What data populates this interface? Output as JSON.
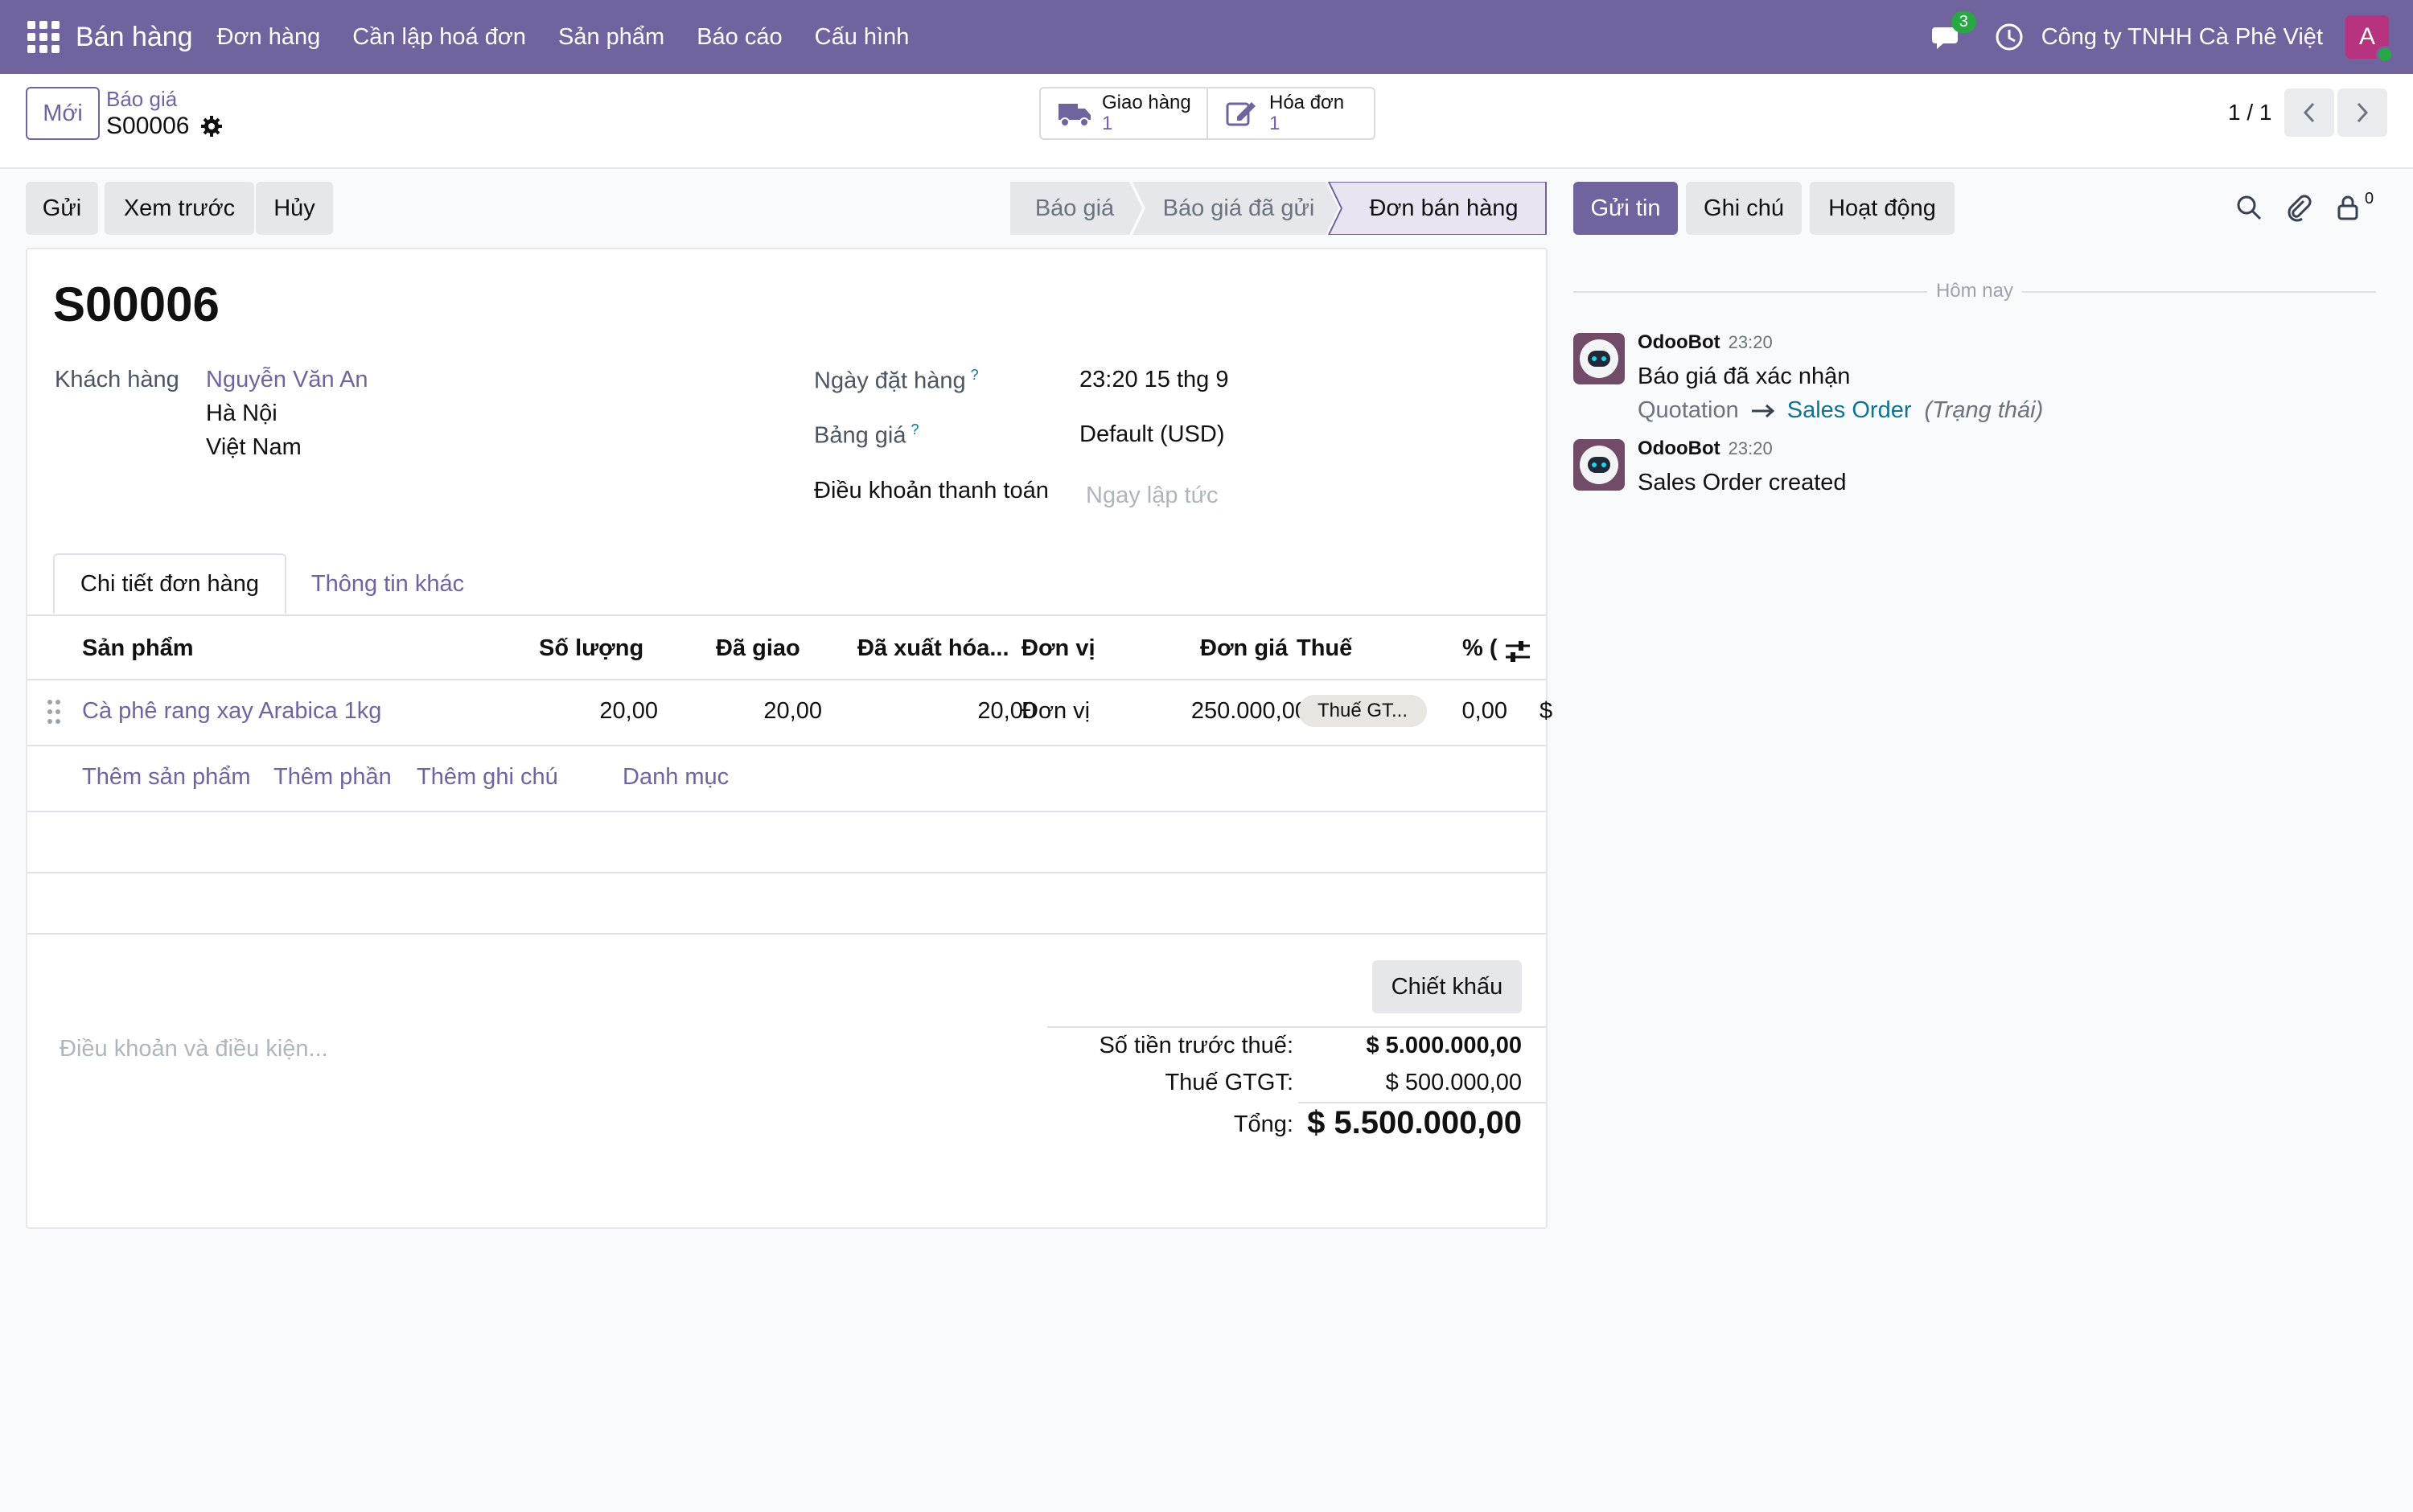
{
  "navbar": {
    "app_name": "Bán hàng",
    "menu": [
      "Đơn hàng",
      "Cần lập hoá đơn",
      "Sản phẩm",
      "Báo cáo",
      "Cấu hình"
    ],
    "message_count": "3",
    "company": "Công ty TNHH Cà Phê Việt",
    "avatar_initial": "A"
  },
  "control": {
    "new_label": "Mới",
    "breadcrumb_parent": "Báo giá",
    "breadcrumb_current": "S00006",
    "smart_delivery_label": "Giao hàng",
    "smart_delivery_count": "1",
    "smart_invoice_label": "Hóa đơn",
    "smart_invoice_count": "1",
    "pager": "1 / 1"
  },
  "actions": {
    "send": "Gửi",
    "preview": "Xem trước",
    "cancel": "Hủy"
  },
  "status": {
    "stages": [
      "Báo giá",
      "Báo giá đã gửi",
      "Đơn bán hàng"
    ],
    "current_index": 2
  },
  "form": {
    "order_name": "S00006",
    "customer_label": "Khách hàng",
    "customer_name": "Nguyễn Văn An",
    "customer_city": "Hà Nội",
    "customer_country": "Việt Nam",
    "order_date_label": "Ngày đặt hàng",
    "order_date_value": "23:20 15 thg 9",
    "pricelist_label": "Bảng giá",
    "pricelist_value": "Default (USD)",
    "payment_terms_label": "Điều khoản thanh toán",
    "payment_terms_placeholder": "Ngay lập tức",
    "help_mark": "?",
    "tabs": [
      "Chi tiết đơn hàng",
      "Thông tin khác"
    ]
  },
  "lines": {
    "headers": {
      "product": "Sản phẩm",
      "qty": "Số lượng",
      "delivered": "Đã giao",
      "invoiced": "Đã xuất hóa...",
      "uom": "Đơn vị",
      "price": "Đơn giá",
      "tax": "Thuế",
      "discount": "% (",
      "subtotal": "$"
    },
    "rows": [
      {
        "product": "Cà phê rang xay Arabica 1kg",
        "qty": "20,00",
        "delivered": "20,00",
        "invoiced": "20,00",
        "uom": "Đơn vị",
        "price": "250.000,00",
        "tax": "Thuế GT...",
        "discount": "0,00",
        "subtotal": "$"
      }
    ],
    "add_links": {
      "product": "Thêm sản phẩm",
      "section": "Thêm phần",
      "note": "Thêm ghi chú",
      "catalog": "Danh mục"
    }
  },
  "totals": {
    "discount_button": "Chiết khấu",
    "terms_placeholder": "Điều khoản và điều kiện...",
    "untaxed_label": "Số tiền trước thuế:",
    "untaxed_value": "$ 5.000.000,00",
    "tax_label": "Thuế GTGT:",
    "tax_value": "$ 500.000,00",
    "total_label": "Tổng:",
    "total_value": "$ 5.500.000,00"
  },
  "chatter": {
    "send_message": "Gửi tin",
    "log_note": "Ghi chú",
    "activities": "Hoạt động",
    "followers_count": "0",
    "date_divider": "Hôm nay",
    "messages": [
      {
        "author": "OdooBot",
        "time": "23:20",
        "body": "Báo giá đã xác nhận",
        "tracking_old": "Quotation",
        "tracking_new": "Sales Order",
        "tracking_field": "(Trạng thái)"
      },
      {
        "author": "OdooBot",
        "time": "23:20",
        "body": "Sales Order created"
      }
    ]
  },
  "colors": {
    "brand": "#71639e",
    "link_teal": "#0e7490",
    "online": "#28a745"
  }
}
